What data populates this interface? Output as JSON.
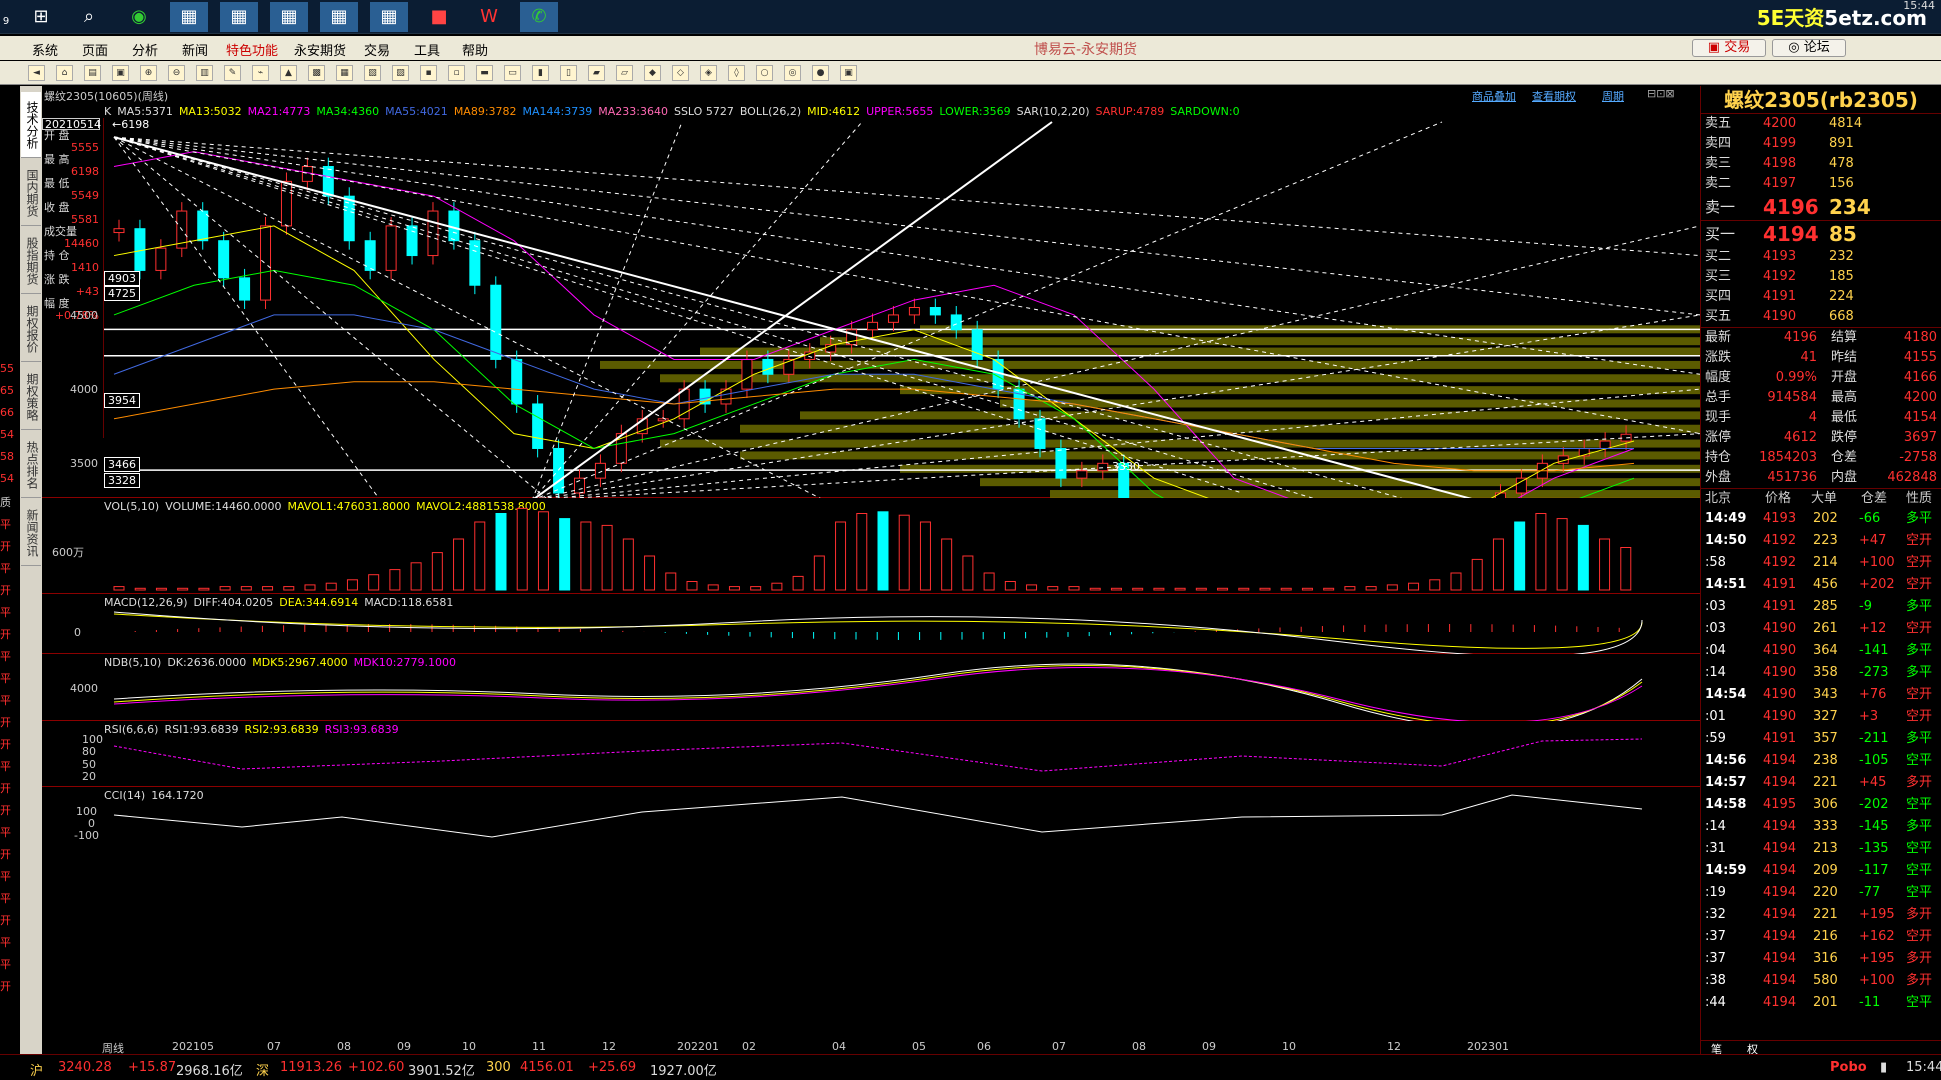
{
  "taskbar": {
    "corner": "9",
    "brand_a": "5E天资",
    "brand_b": "5etz.com",
    "time": "15:44"
  },
  "menu": {
    "items": [
      "系统",
      "页面",
      "分析",
      "新闻",
      "特色功能",
      "永安期货",
      "交易",
      "工具",
      "帮助"
    ],
    "app_title": "博易云-永安期货",
    "trade_label": "交易",
    "forum_label": "论坛"
  },
  "chart": {
    "symbol_header": "螺纹2305(10605)(周线)",
    "header_links": [
      "商品叠加",
      "查看期权",
      "周期"
    ],
    "k_legend": [
      {
        "t": "K",
        "c": "#ddd"
      },
      {
        "t": "MA5:5371",
        "c": "#ddd"
      },
      {
        "t": "MA13:5032",
        "c": "#ffff00"
      },
      {
        "t": "MA21:4773",
        "c": "#ff00ff"
      },
      {
        "t": "MA34:4360",
        "c": "#00ff00"
      },
      {
        "t": "MA55:4021",
        "c": "#4169e1"
      },
      {
        "t": "MA89:3782",
        "c": "#ff8c00"
      },
      {
        "t": "MA144:3739",
        "c": "#1e90ff"
      },
      {
        "t": "MA233:3640",
        "c": "#ff69b4"
      },
      {
        "t": "SSLO 5727",
        "c": "#ddd"
      },
      {
        "t": "BOLL(26,2)",
        "c": "#ddd"
      },
      {
        "t": "MID:4612",
        "c": "#ffff00"
      },
      {
        "t": "UPPER:5655",
        "c": "#ff00ff"
      },
      {
        "t": "LOWER:3569",
        "c": "#00ff00"
      },
      {
        "t": "SAR(10,2,20)",
        "c": "#ddd"
      },
      {
        "t": "SARUP:4789",
        "c": "#ff3030"
      },
      {
        "t": "SARDOWN:0",
        "c": "#00ff00"
      }
    ],
    "ohlc": [
      {
        "k": "20210514",
        "v": ""
      },
      {
        "k": "开 盘",
        "v": "5555"
      },
      {
        "k": "最 高",
        "v": "6198"
      },
      {
        "k": "最 低",
        "v": "5549"
      },
      {
        "k": "收 盘",
        "v": "5581"
      },
      {
        "k": "成交量",
        "v": "14460"
      },
      {
        "k": "持 仓",
        "v": "1410"
      },
      {
        "k": "涨 跌",
        "v": "+43"
      },
      {
        "k": "幅 度",
        "v": "+0.78%"
      }
    ],
    "high_marker": "6198",
    "low_marker": "3330",
    "y_ticks": [
      "4500",
      "4000",
      "3500"
    ],
    "levels": [
      "4903",
      "4725",
      "3954",
      "3466",
      "3328"
    ],
    "x_ticks": [
      "周线",
      "202105",
      "07",
      "08",
      "09",
      "10",
      "11",
      "12",
      "202201",
      "02",
      "04",
      "05",
      "06",
      "07",
      "08",
      "09",
      "10",
      "12",
      "202301"
    ]
  },
  "vol": {
    "legend": [
      {
        "t": "VOL(5,10)",
        "c": "#ddd"
      },
      {
        "t": "VOLUME:14460.0000",
        "c": "#ddd"
      },
      {
        "t": "MAVOL1:476031.8000",
        "c": "#ffff00"
      },
      {
        "t": "MAVOL2:4881538.8000",
        "c": "#ffff00"
      }
    ],
    "y_tick": "600万"
  },
  "macd": {
    "legend": [
      {
        "t": "MACD(12,26,9)",
        "c": "#ddd"
      },
      {
        "t": "DIFF:404.0205",
        "c": "#ddd"
      },
      {
        "t": "DEA:344.6914",
        "c": "#ffff00"
      },
      {
        "t": "MACD:118.6581",
        "c": "#ddd"
      }
    ],
    "y_tick": "0"
  },
  "ndb": {
    "legend": [
      {
        "t": "NDB(5,10)",
        "c": "#ddd"
      },
      {
        "t": "DK:2636.0000",
        "c": "#ddd"
      },
      {
        "t": "MDK5:2967.4000",
        "c": "#ffff00"
      },
      {
        "t": "MDK10:2779.1000",
        "c": "#ff00ff"
      }
    ],
    "y_tick": "4000"
  },
  "rsi": {
    "legend": [
      {
        "t": "RSI(6,6,6)",
        "c": "#ddd"
      },
      {
        "t": "RSI1:93.6839",
        "c": "#ddd"
      },
      {
        "t": "RSI2:93.6839",
        "c": "#ffff00"
      },
      {
        "t": "RSI3:93.6839",
        "c": "#ff00ff"
      }
    ],
    "y_ticks": [
      "100",
      "80",
      "50",
      "20",
      "0"
    ]
  },
  "cci": {
    "legend": [
      {
        "t": "CCI(14)",
        "c": "#ddd"
      },
      {
        "t": "164.1720",
        "c": "#ddd"
      }
    ],
    "y_ticks": [
      "100",
      "0",
      "-100"
    ]
  },
  "quote": {
    "title": "螺纹2305(rb2305)",
    "asks": [
      {
        "l": "卖五",
        "p": "4200",
        "q": "4814"
      },
      {
        "l": "卖四",
        "p": "4199",
        "q": "891"
      },
      {
        "l": "卖三",
        "p": "4198",
        "q": "478"
      },
      {
        "l": "卖二",
        "p": "4197",
        "q": "156"
      },
      {
        "l": "卖一",
        "p": "4196",
        "q": "234"
      }
    ],
    "bids": [
      {
        "l": "买一",
        "p": "4194",
        "q": "85"
      },
      {
        "l": "买二",
        "p": "4193",
        "q": "232"
      },
      {
        "l": "买三",
        "p": "4192",
        "q": "185"
      },
      {
        "l": "买四",
        "p": "4191",
        "q": "224"
      },
      {
        "l": "买五",
        "p": "4190",
        "q": "668"
      }
    ],
    "stats": [
      [
        "最新",
        "4196",
        "结算",
        "4180"
      ],
      [
        "涨跌",
        "41",
        "昨结",
        "4155"
      ],
      [
        "幅度",
        "0.99%",
        "开盘",
        "4166"
      ],
      [
        "总手",
        "914584",
        "最高",
        "4200"
      ],
      [
        "现手",
        "4",
        "最低",
        "4154"
      ],
      [
        "涨停",
        "4612",
        "跌停",
        "3697"
      ],
      [
        "持仓",
        "1854203",
        "仓差",
        "-2758"
      ],
      [
        "外盘",
        "451736",
        "内盘",
        "462848"
      ]
    ],
    "tick_head": [
      "北京",
      "价格",
      "大单",
      "仓差",
      "性质"
    ],
    "ticks": [
      [
        "14:49",
        "4193",
        "202",
        "-66",
        "多平"
      ],
      [
        "14:50",
        "4192",
        "223",
        "+47",
        "空开"
      ],
      [
        ":58",
        "4192",
        "214",
        "+100",
        "空开"
      ],
      [
        "14:51",
        "4191",
        "456",
        "+202",
        "空开"
      ],
      [
        ":03",
        "4191",
        "285",
        "-9",
        "多平"
      ],
      [
        ":03",
        "4190",
        "261",
        "+12",
        "空开"
      ],
      [
        ":04",
        "4190",
        "364",
        "-141",
        "多平"
      ],
      [
        ":14",
        "4190",
        "358",
        "-273",
        "多平"
      ],
      [
        "14:54",
        "4190",
        "343",
        "+76",
        "空开"
      ],
      [
        ":01",
        "4190",
        "327",
        "+3",
        "空开"
      ],
      [
        ":59",
        "4191",
        "357",
        "-211",
        "多平"
      ],
      [
        "14:56",
        "4194",
        "238",
        "-105",
        "空平"
      ],
      [
        "14:57",
        "4194",
        "221",
        "+45",
        "多开"
      ],
      [
        "14:58",
        "4195",
        "306",
        "-202",
        "空平"
      ],
      [
        ":14",
        "4194",
        "333",
        "-145",
        "多平"
      ],
      [
        ":31",
        "4194",
        "213",
        "-135",
        "空平"
      ],
      [
        "14:59",
        "4194",
        "209",
        "-117",
        "空平"
      ],
      [
        ":19",
        "4194",
        "220",
        "-77",
        "空平"
      ],
      [
        ":32",
        "4194",
        "221",
        "+195",
        "多开"
      ],
      [
        ":37",
        "4194",
        "216",
        "+162",
        "空开"
      ],
      [
        ":37",
        "4194",
        "316",
        "+195",
        "多开"
      ],
      [
        ":38",
        "4194",
        "580",
        "+100",
        "多开"
      ],
      [
        ":44",
        "4194",
        "201",
        "-11",
        "空平"
      ]
    ],
    "bottom_tabs": [
      "笔",
      "权"
    ]
  },
  "status": {
    "items": [
      {
        "t": "沪",
        "c": "#ffd24d"
      },
      {
        "t": "3240.28",
        "c": "#ff3030"
      },
      {
        "t": "+15.87",
        "c": "#ff3030"
      },
      {
        "t": "2968.16亿",
        "c": "#ddd"
      },
      {
        "t": "深",
        "c": "#ffd24d"
      },
      {
        "t": "11913.26",
        "c": "#ff3030"
      },
      {
        "t": "+102.60",
        "c": "#ff3030"
      },
      {
        "t": "3901.52亿",
        "c": "#ddd"
      },
      {
        "t": "300",
        "c": "#ffd24d"
      },
      {
        "t": "4156.01",
        "c": "#ff3030"
      },
      {
        "t": "+25.69",
        "c": "#ff3030"
      },
      {
        "t": "1927.00亿",
        "c": "#ddd"
      }
    ],
    "right": "Pobo",
    "time": "15:44"
  },
  "vtabs": [
    "技术分析",
    "国内期货",
    "股指期货",
    "期权报价",
    "期权策略",
    "热点排名",
    "新闻资讯"
  ],
  "leftstrip": [
    "55",
    "65",
    "66",
    "54",
    "58",
    "54",
    "质",
    "平",
    "开",
    "平",
    "开",
    "平",
    "开",
    "平",
    "平",
    "平",
    "开",
    "开",
    "平",
    "开",
    "开",
    "平",
    "开",
    "平",
    "平",
    "开",
    "平",
    "平",
    "开"
  ]
}
